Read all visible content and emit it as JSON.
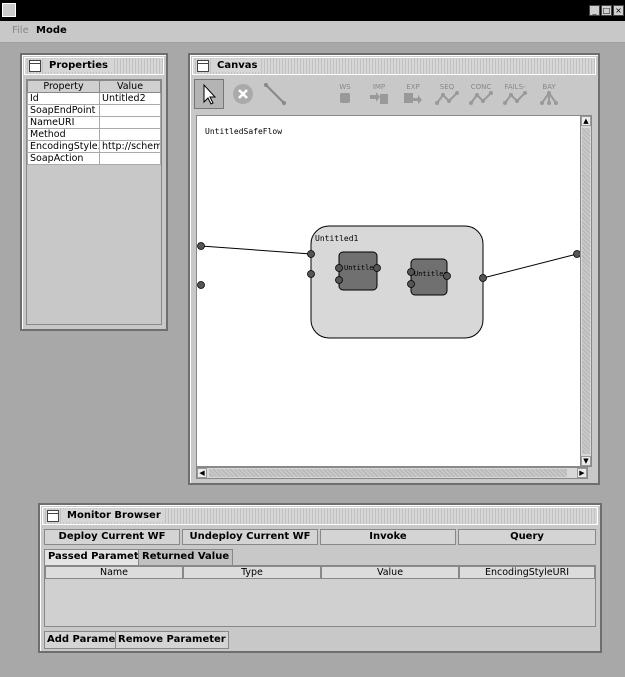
{
  "menu": {
    "file": "File",
    "mode": "Mode"
  },
  "window_controls": [
    "_",
    "□",
    "×"
  ],
  "properties": {
    "title": "Properties",
    "columns": [
      "Property",
      "Value"
    ],
    "rows": [
      [
        "Id",
        "Untitled2"
      ],
      [
        "SoapEndPoint",
        ""
      ],
      [
        "NameURI",
        ""
      ],
      [
        "Method",
        ""
      ],
      [
        "EncodingStyle...",
        "http://schemas..."
      ],
      [
        "SoapAction",
        ""
      ]
    ]
  },
  "canvas": {
    "title": "Canvas",
    "tools": [
      {
        "label": "",
        "icon": "pointer-icon",
        "selected": true
      },
      {
        "label": "",
        "icon": "delete-icon",
        "selected": false
      },
      {
        "label": "",
        "icon": "connector-icon",
        "selected": false
      },
      {
        "label": "WS",
        "icon": "web-service-icon",
        "selected": false
      },
      {
        "label": "IMP",
        "icon": "import-icon",
        "selected": false
      },
      {
        "label": "EXP",
        "icon": "export-icon",
        "selected": false
      },
      {
        "label": "SEQ",
        "icon": "sequence-icon",
        "selected": false
      },
      {
        "label": "CONC",
        "icon": "concurrent-icon",
        "selected": false
      },
      {
        "label": "FAILS-",
        "icon": "failsafe-icon",
        "selected": false
      },
      {
        "label": "BAY",
        "icon": "bayesian-icon",
        "selected": false
      }
    ],
    "flow_label": "UntitledSafeFlow",
    "group_label": "Untitled1",
    "node1_label": "Untitled",
    "node2_label": "Untitled"
  },
  "monitor": {
    "title": "Monitor Browser",
    "buttons": [
      "Deploy Current WF",
      "Undeploy Current WF",
      "Invoke",
      "Query"
    ],
    "tabs": [
      "Passed Parameters",
      "Returned Value"
    ],
    "columns": [
      "Name",
      "Type",
      "Value",
      "EncodingStyleURI"
    ],
    "footer_buttons": [
      "Add Parameter",
      "Remove Parameter"
    ]
  }
}
